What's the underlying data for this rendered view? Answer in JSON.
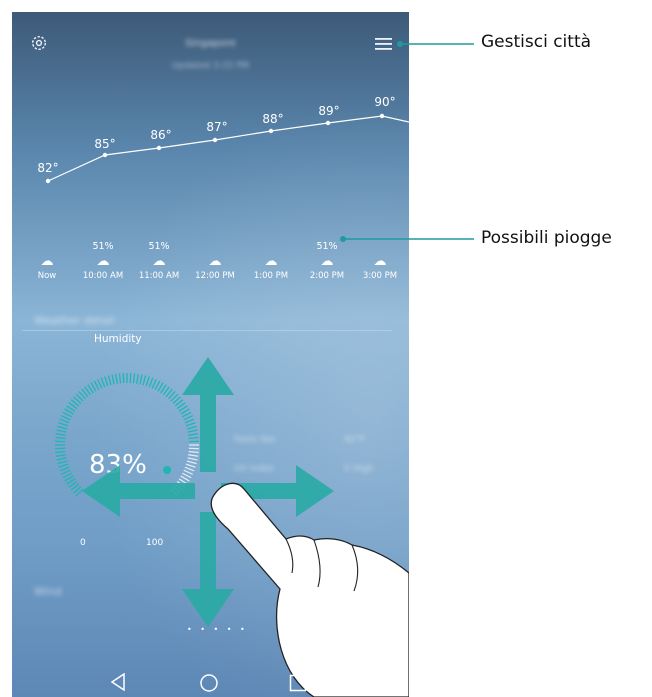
{
  "topbar": {
    "settings_icon": "gear-icon",
    "menu_icon": "menu-icon",
    "city": "Singapore",
    "city_sub": "Updated 3:15 PM"
  },
  "hourly": [
    {
      "temp": "82°",
      "rain": "",
      "time": "Now"
    },
    {
      "temp": "85°",
      "rain": "51%",
      "time": "10:00 AM"
    },
    {
      "temp": "86°",
      "rain": "51%",
      "time": "11:00 AM"
    },
    {
      "temp": "87°",
      "rain": "",
      "time": "12:00 PM"
    },
    {
      "temp": "88°",
      "rain": "",
      "time": "1:00 PM"
    },
    {
      "temp": "89°",
      "rain": "51%",
      "time": "2:00 PM"
    },
    {
      "temp": "90°",
      "rain": "",
      "time": "3:00 PM"
    }
  ],
  "details": {
    "section_label": "Weather detail",
    "humidity_title": "Humidity",
    "humidity_value": "83%",
    "humidity_level": 0.83,
    "scale_min": "0",
    "scale_max": "100",
    "feels_like_label": "Feels like",
    "feels_like_value": "92°F",
    "uv_label": "UV index",
    "uv_value": "5 High",
    "wind_label": "Wind"
  },
  "page_dots": "• • • • •",
  "callouts": {
    "manage_cities": "Gestisci città",
    "rain_chance": "Possibili piogge"
  },
  "colors": {
    "humidity_accent": "#1fb5b3",
    "arrow": "#2aa9a6",
    "callout_line": "#1f9aa0"
  }
}
